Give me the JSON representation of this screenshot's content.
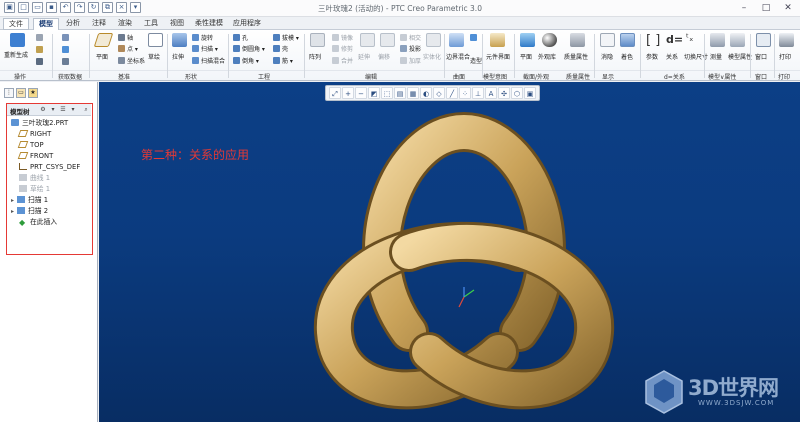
{
  "window": {
    "title": "三叶玫瑰2 (活动的) - PTC Creo Parametric 3.0"
  },
  "tabs": [
    {
      "label": "文件"
    },
    {
      "label": "模型"
    },
    {
      "label": "分析"
    },
    {
      "label": "注释"
    },
    {
      "label": "渲染"
    },
    {
      "label": "工具"
    },
    {
      "label": "视图"
    },
    {
      "label": "柔性建模"
    },
    {
      "label": "应用程序"
    }
  ],
  "ribbon": {
    "groups": {
      "operations": "操作",
      "get_data": "获取数据",
      "datum": "基准",
      "shapes": "形状",
      "engineering": "工程",
      "editing": "编辑",
      "surfaces": "曲面",
      "model_intent": "模型意图",
      "appearance": "截面/外观",
      "model_display": "质量属性",
      "show": "显示",
      "relations": "d=关系",
      "model_props": "模型∨属性",
      "window": "窗口",
      "print": "打印"
    },
    "buttons": {
      "regen": "重新生成",
      "plane": "平面",
      "axis": "轴",
      "point": "点",
      "csys": "坐标系",
      "sketch": "草绘",
      "extrude": "拉伸",
      "revolve": "旋转",
      "sweep": "扫描",
      "swept_blend": "扫描混合",
      "hole": "孔",
      "round": "倒圆角",
      "chamfer": "倒角",
      "draft": "拔模",
      "shell": "壳",
      "rib": "筋",
      "pattern": "阵列",
      "mirror": "镜像",
      "trim": "修剪",
      "merge": "合并",
      "extend": "延伸",
      "offset": "偏移",
      "intersect": "相交",
      "project": "投影",
      "thicken": "加厚",
      "solidify": "实体化",
      "boundary_blend": "边界混合",
      "style": "造型",
      "component_interface": "元件界面",
      "plane_section": "平面",
      "appearance_lib": "外观库",
      "mass_props": "质量属性",
      "hidden": "消隐",
      "shading": "着色",
      "params": "参数",
      "relations_btn": "关系",
      "switch_dims": "切换尺寸",
      "measure": "测量",
      "model_properties": "模型属性",
      "window_btn": "窗口",
      "print_btn": "打印"
    }
  },
  "tree": {
    "title": "模型树",
    "items": [
      {
        "label": "三叶玫瑰2.PRT"
      },
      {
        "label": "RIGHT"
      },
      {
        "label": "TOP"
      },
      {
        "label": "FRONT"
      },
      {
        "label": "PRT_CSYS_DEF"
      },
      {
        "label": "曲线 1"
      },
      {
        "label": "草绘 1"
      },
      {
        "label": "扫描 1"
      },
      {
        "label": "扫描 2"
      },
      {
        "label": "在此插入"
      }
    ]
  },
  "viewport": {
    "annotation": "第二种：关系的应用",
    "watermark_text": "3D世界网",
    "watermark_url": "WWW.3DSJW.COM"
  },
  "colors": {
    "accent_red": "#e53935",
    "viewport_bg": "#0b3b7f",
    "knot_gold": "#c9a25a"
  }
}
